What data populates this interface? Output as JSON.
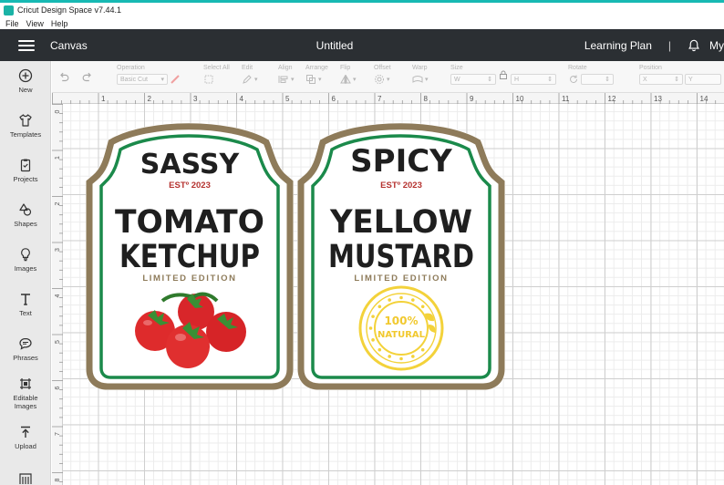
{
  "window": {
    "title": "Cricut Design Space  v7.44.1"
  },
  "menu": {
    "items": [
      "File",
      "View",
      "Help"
    ]
  },
  "header": {
    "canvas_label": "Canvas",
    "doc_title": "Untitled",
    "learning_plan": "Learning Plan",
    "separator": "|",
    "account": "My"
  },
  "sidebar": {
    "items": [
      {
        "label": "New",
        "icon": "plus-circle-icon"
      },
      {
        "label": "Templates",
        "icon": "shirt-icon"
      },
      {
        "label": "Projects",
        "icon": "clipboard-icon"
      },
      {
        "label": "Shapes",
        "icon": "shapes-icon"
      },
      {
        "label": "Images",
        "icon": "bulb-icon"
      },
      {
        "label": "Text",
        "icon": "text-icon"
      },
      {
        "label": "Phrases",
        "icon": "speech-bubble-icon"
      },
      {
        "label": "Editable Images",
        "icon": "editable-images-icon"
      },
      {
        "label": "Upload",
        "icon": "upload-icon"
      }
    ]
  },
  "toolbar": {
    "operation_label": "Operation",
    "operation_value": "Basic Cut",
    "select_all_label": "Select All",
    "edit_label": "Edit",
    "align_label": "Align",
    "arrange_label": "Arrange",
    "flip_label": "Flip",
    "offset_label": "Offset",
    "warp_label": "Warp",
    "size_label": "Size",
    "w_label": "W",
    "h_label": "H",
    "rotate_label": "Rotate",
    "position_label": "Position",
    "x_label": "X",
    "y_label": "Y"
  },
  "ruler": {
    "top_numbers": [
      "1",
      "2",
      "3",
      "4",
      "5",
      "6",
      "7",
      "8",
      "9",
      "10",
      "11",
      "12",
      "13",
      "14"
    ],
    "left_numbers": [
      "0",
      "1",
      "2",
      "3",
      "4",
      "5",
      "6",
      "7",
      "8"
    ]
  },
  "labels": [
    {
      "top_word": "SASSY",
      "est": "ESTº 2023",
      "line1": "TOMATO",
      "line2": "KETCHUP",
      "edition": "LIMITED EDITION",
      "art": "tomatoes-icon"
    },
    {
      "top_word": "SPICY",
      "est": "ESTº 2023",
      "line1": "YELLOW",
      "line2": "MUSTARD",
      "edition": "LIMITED EDITION",
      "art": "natural-seal-icon",
      "seal_line1": "100%",
      "seal_line2": "NATURAL"
    }
  ],
  "colors": {
    "accent": "#17b9b3",
    "header_bg": "#2b2f33",
    "label_tan": "#8e7b5a",
    "label_green": "#1b8a4b",
    "est_red": "#b5322f",
    "tomato_red": "#d8262a",
    "mustard_yellow": "#f3d23a"
  }
}
